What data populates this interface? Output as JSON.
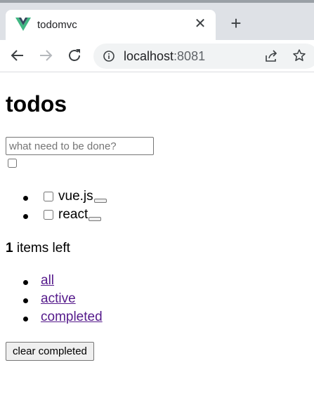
{
  "browser": {
    "tab_title": "todomvc",
    "close_glyph": "✕",
    "new_tab_glyph": "+",
    "url_host": "localhost",
    "url_port": ":8081"
  },
  "app": {
    "title": "todos",
    "new_todo_placeholder": "what need to be done?",
    "todos": [
      {
        "label": "vue.js",
        "completed": false
      },
      {
        "label": "react",
        "completed": false
      }
    ],
    "count_number": "1",
    "count_suffix": " items left",
    "filters": [
      "all",
      "active",
      "completed"
    ],
    "clear_completed_label": "clear completed"
  },
  "colors": {
    "link": "#551a8b",
    "tabstrip": "#dee1e6",
    "omnibox": "#f1f3f4"
  }
}
